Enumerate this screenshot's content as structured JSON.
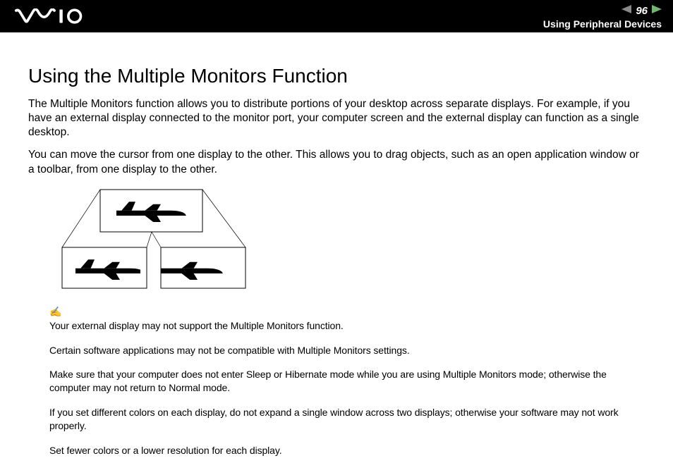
{
  "header": {
    "page_number": "96",
    "section": "Using Peripheral Devices"
  },
  "title": "Using the Multiple Monitors Function",
  "paragraphs": [
    "The Multiple Monitors function allows you to distribute portions of your desktop across separate displays. For example, if you have an external display connected to the monitor port, your computer screen and the external display can function as a single desktop.",
    "You can move the cursor from one display to the other. This allows you to drag objects, such as an open application window or a toolbar, from one display to the other."
  ],
  "notes": [
    "Your external display may not support the Multiple Monitors function.",
    "Certain software applications may not be compatible with Multiple Monitors settings.",
    "Make sure that your computer does not enter Sleep or Hibernate mode while you are using Multiple Monitors mode; otherwise the computer may not return to Normal mode.",
    "If you set different colors on each display, do not expand a single window across two displays; otherwise your software may not work properly.",
    "Set fewer colors or a lower resolution for each display."
  ]
}
